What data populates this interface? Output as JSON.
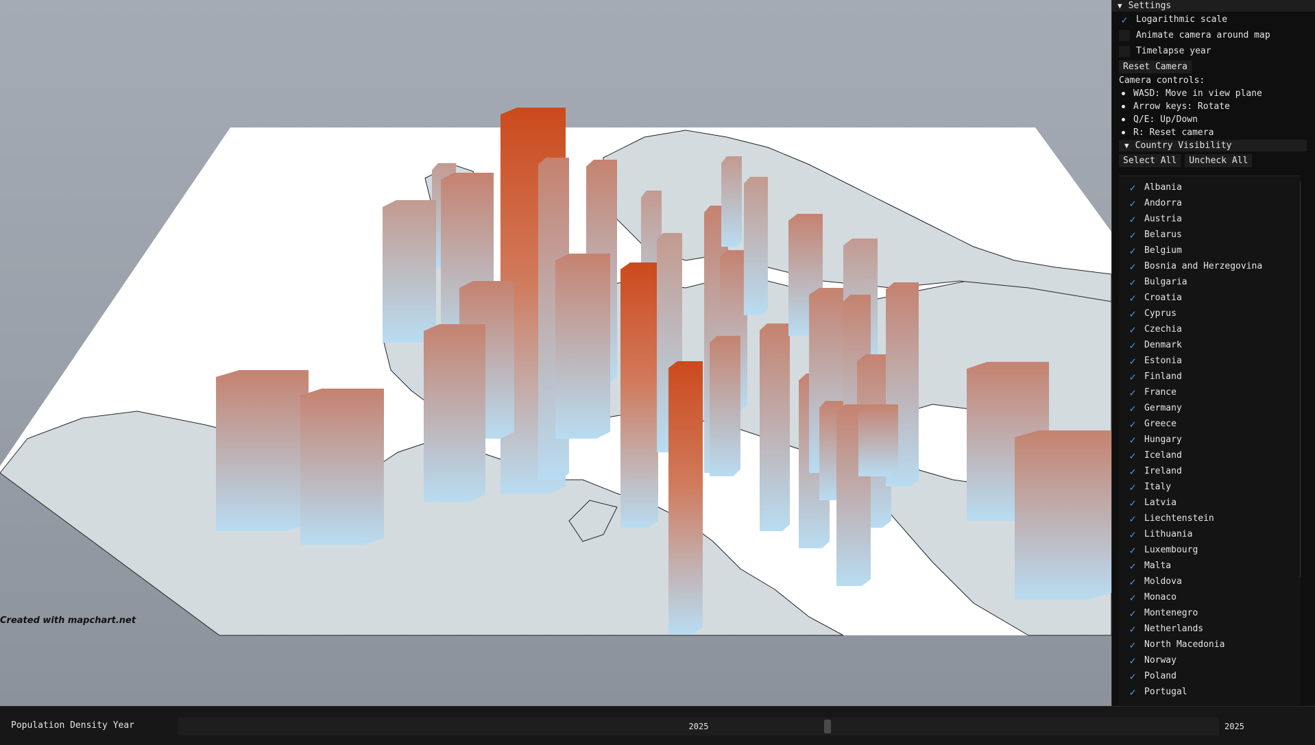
{
  "credit": "Created with mapchart.net",
  "settings": {
    "header": "Settings",
    "log_scale": {
      "label": "Logarithmic scale",
      "checked": true
    },
    "animate_camera": {
      "label": "Animate camera around map",
      "checked": false
    },
    "timelapse": {
      "label": "Timelapse year",
      "checked": false
    },
    "reset_camera": "Reset Camera",
    "controls_title": "Camera controls:",
    "controls": [
      "WASD: Move in view plane",
      "Arrow keys: Rotate",
      "Q/E: Up/Down",
      "R: Reset camera"
    ],
    "country_visibility": "Country Visibility",
    "select_all": "Select All",
    "uncheck_all": "Uncheck All",
    "countries": [
      "Albania",
      "Andorra",
      "Austria",
      "Belarus",
      "Belgium",
      "Bosnia and Herzegovina",
      "Bulgaria",
      "Croatia",
      "Cyprus",
      "Czechia",
      "Denmark",
      "Estonia",
      "Finland",
      "France",
      "Germany",
      "Greece",
      "Hungary",
      "Iceland",
      "Ireland",
      "Italy",
      "Latvia",
      "Liechtenstein",
      "Lithuania",
      "Luxembourg",
      "Malta",
      "Moldova",
      "Monaco",
      "Montenegro",
      "Netherlands",
      "North Macedonia",
      "Norway",
      "Poland",
      "Portugal"
    ]
  },
  "bottom": {
    "label": "Population Density Year",
    "value": "2025",
    "max": "2025"
  },
  "colors": {
    "bar_high": "#cc4a1c",
    "bar_low": "#b8dcf2",
    "land": "#d3dbdf",
    "sea": "#ffffff",
    "accent": "#4d9be6"
  }
}
